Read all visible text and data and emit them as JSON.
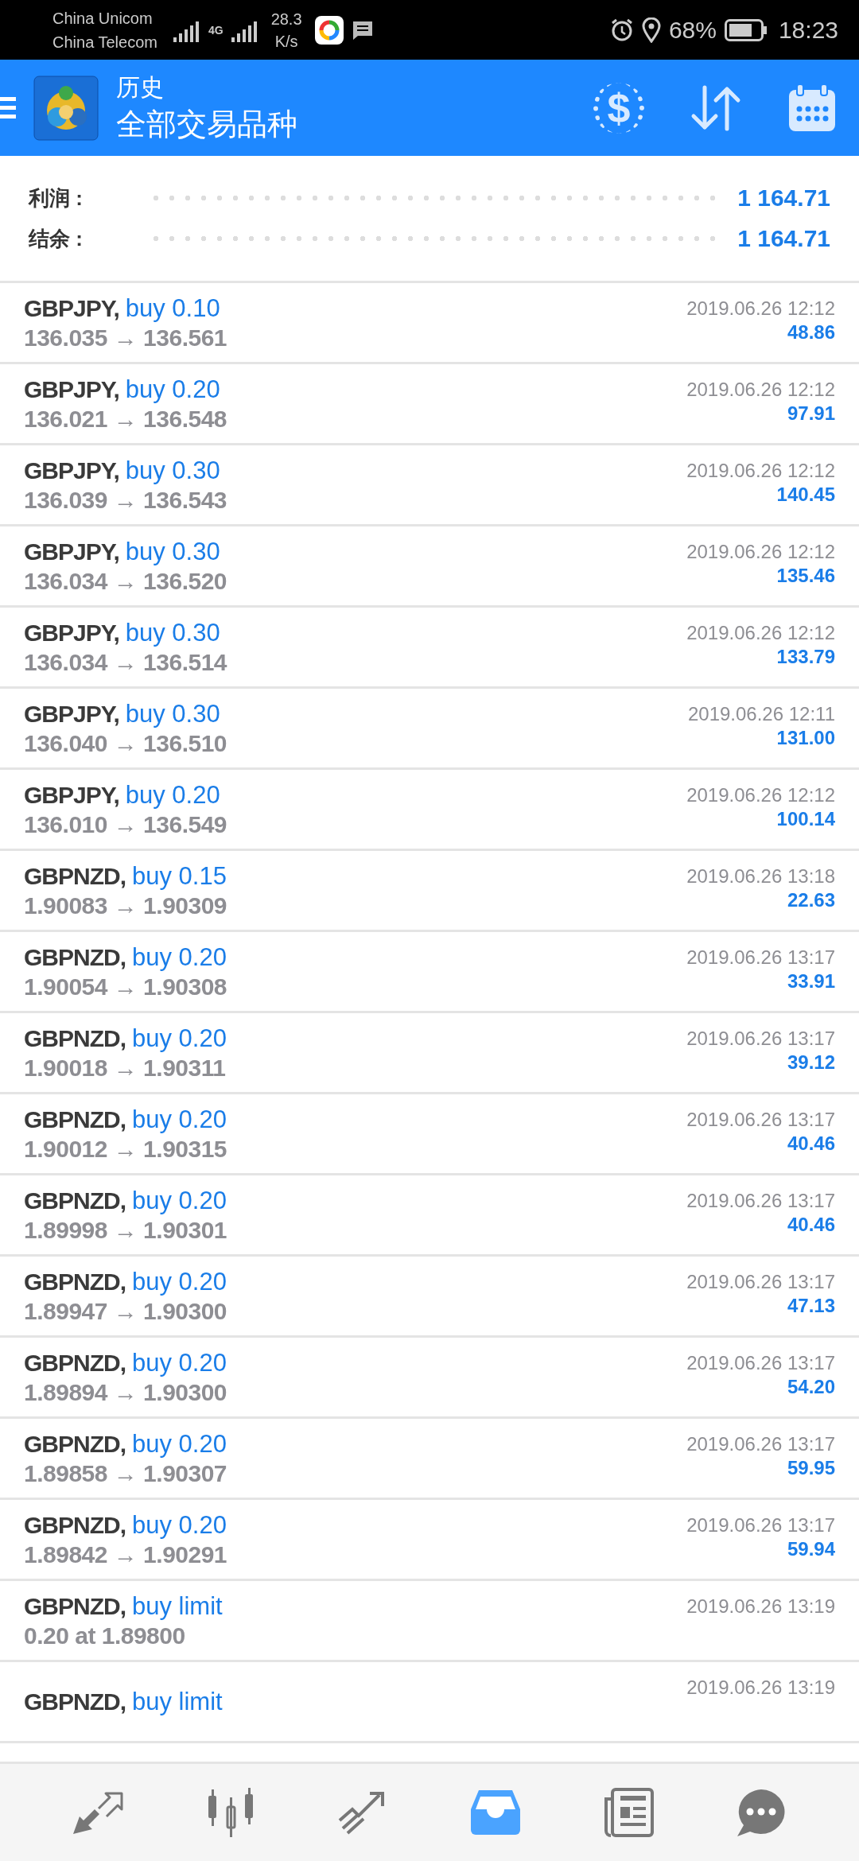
{
  "status_bar": {
    "carriers": [
      "China Unicom",
      "China Telecom"
    ],
    "network": "4G",
    "speed": "28.3",
    "speed_unit": "K/s",
    "battery": "68%",
    "time": "18:23"
  },
  "header": {
    "title": "历史",
    "subtitle": "全部交易品种",
    "exchange_glyph": "$"
  },
  "summary": [
    {
      "label": "利润 :",
      "value": "1 164.71"
    },
    {
      "label": "结余 :",
      "value": "1 164.71"
    }
  ],
  "deals": [
    {
      "kind": "deal",
      "symbol": "GBPJPY,",
      "side": "buy 0.10",
      "detail": "136.035 → 136.561",
      "time": "2019.06.26 12:12",
      "profit": "48.86"
    },
    {
      "kind": "deal",
      "symbol": "GBPJPY,",
      "side": "buy 0.20",
      "detail": "136.021 → 136.548",
      "time": "2019.06.26 12:12",
      "profit": "97.91"
    },
    {
      "kind": "deal",
      "symbol": "GBPJPY,",
      "side": "buy 0.30",
      "detail": "136.039 → 136.543",
      "time": "2019.06.26 12:12",
      "profit": "140.45"
    },
    {
      "kind": "deal",
      "symbol": "GBPJPY,",
      "side": "buy 0.30",
      "detail": "136.034 → 136.520",
      "time": "2019.06.26 12:12",
      "profit": "135.46"
    },
    {
      "kind": "deal",
      "symbol": "GBPJPY,",
      "side": "buy 0.30",
      "detail": "136.034 → 136.514",
      "time": "2019.06.26 12:12",
      "profit": "133.79"
    },
    {
      "kind": "deal",
      "symbol": "GBPJPY,",
      "side": "buy 0.30",
      "detail": "136.040 → 136.510",
      "time": "2019.06.26 12:11",
      "profit": "131.00"
    },
    {
      "kind": "deal",
      "symbol": "GBPJPY,",
      "side": "buy 0.20",
      "detail": "136.010 → 136.549",
      "time": "2019.06.26 12:12",
      "profit": "100.14"
    },
    {
      "kind": "deal",
      "symbol": "GBPNZD,",
      "side": "buy 0.15",
      "detail": "1.90083 → 1.90309",
      "time": "2019.06.26 13:18",
      "profit": "22.63"
    },
    {
      "kind": "deal",
      "symbol": "GBPNZD,",
      "side": "buy 0.20",
      "detail": "1.90054 → 1.90308",
      "time": "2019.06.26 13:17",
      "profit": "33.91"
    },
    {
      "kind": "deal",
      "symbol": "GBPNZD,",
      "side": "buy 0.20",
      "detail": "1.90018 → 1.90311",
      "time": "2019.06.26 13:17",
      "profit": "39.12"
    },
    {
      "kind": "deal",
      "symbol": "GBPNZD,",
      "side": "buy 0.20",
      "detail": "1.90012 → 1.90315",
      "time": "2019.06.26 13:17",
      "profit": "40.46"
    },
    {
      "kind": "deal",
      "symbol": "GBPNZD,",
      "side": "buy 0.20",
      "detail": "1.89998 → 1.90301",
      "time": "2019.06.26 13:17",
      "profit": "40.46"
    },
    {
      "kind": "deal",
      "symbol": "GBPNZD,",
      "side": "buy 0.20",
      "detail": "1.89947 → 1.90300",
      "time": "2019.06.26 13:17",
      "profit": "47.13"
    },
    {
      "kind": "deal",
      "symbol": "GBPNZD,",
      "side": "buy 0.20",
      "detail": "1.89894 → 1.90300",
      "time": "2019.06.26 13:17",
      "profit": "54.20"
    },
    {
      "kind": "deal",
      "symbol": "GBPNZD,",
      "side": "buy 0.20",
      "detail": "1.89858 → 1.90307",
      "time": "2019.06.26 13:17",
      "profit": "59.95"
    },
    {
      "kind": "deal",
      "symbol": "GBPNZD,",
      "side": "buy 0.20",
      "detail": "1.89842 → 1.90291",
      "time": "2019.06.26 13:17",
      "profit": "59.94"
    },
    {
      "kind": "order",
      "symbol": "GBPNZD,",
      "side": "buy limit",
      "detail": "0.20 at 1.89800",
      "time": "2019.06.26 13:19"
    },
    {
      "kind": "order",
      "symbol": "GBPNZD,",
      "side": "buy limit",
      "time": "2019.06.26 13:19"
    }
  ],
  "bottom_nav": [
    {
      "kind": "quotes",
      "selected": false
    },
    {
      "kind": "chart",
      "selected": false
    },
    {
      "kind": "trade",
      "selected": false
    },
    {
      "kind": "history",
      "selected": true
    },
    {
      "kind": "news",
      "selected": false
    },
    {
      "kind": "chat",
      "selected": false
    }
  ]
}
